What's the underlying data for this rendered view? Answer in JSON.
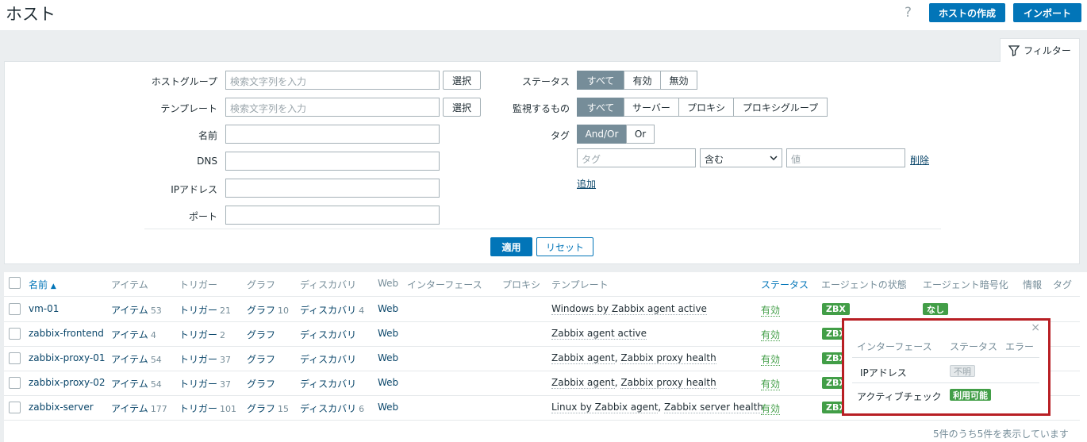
{
  "header": {
    "title": "ホスト",
    "help": "?",
    "create_host": "ホストの作成",
    "import": "インポート"
  },
  "filter": {
    "tab_label": "フィルター",
    "host_group_label": "ホストグループ",
    "host_group_placeholder": "検索文字列を入力",
    "template_label": "テンプレート",
    "template_placeholder": "検索文字列を入力",
    "select_label": "選択",
    "name_label": "名前",
    "dns_label": "DNS",
    "ip_label": "IPアドレス",
    "port_label": "ポート",
    "status_label": "ステータス",
    "status_options": [
      "すべて",
      "有効",
      "無効"
    ],
    "monitored_by_label": "監視するもの",
    "monitored_by_options": [
      "すべて",
      "サーバー",
      "プロキシ",
      "プロキシグループ"
    ],
    "tags_label": "タグ",
    "tags_options": [
      "And/Or",
      "Or"
    ],
    "tag_placeholder": "タグ",
    "tag_operator": "含む",
    "value_placeholder": "値",
    "remove": "削除",
    "add": "追加",
    "apply": "適用",
    "reset": "リセット"
  },
  "table": {
    "headers": {
      "name": "名前",
      "items": "アイテム",
      "triggers": "トリガー",
      "graphs": "グラフ",
      "discovery": "ディスカバリ",
      "web": "Web",
      "interface": "インターフェース",
      "proxy": "プロキシ",
      "templates": "テンプレート",
      "status": "ステータス",
      "agent_status": "エージェントの状態",
      "agent_encryption": "エージェント暗号化",
      "info": "情報",
      "tags": "タグ"
    },
    "rows": [
      {
        "name": "vm-01",
        "items": "アイテム",
        "items_count": "53",
        "triggers": "トリガー",
        "triggers_count": "21",
        "graphs": "グラフ",
        "graphs_count": "10",
        "discovery": "ディスカバリ",
        "discovery_count": "4",
        "web": "Web",
        "template1": "Windows by Zabbix agent active",
        "sep": "",
        "template2": "",
        "status": "有効",
        "agent": "ZBX",
        "encryption": "なし"
      },
      {
        "name": "zabbix-frontend",
        "items": "アイテム",
        "items_count": "4",
        "triggers": "トリガー",
        "triggers_count": "2",
        "graphs": "グラフ",
        "graphs_count": "",
        "discovery": "ディスカバリ",
        "discovery_count": "",
        "web": "Web",
        "template1": "Zabbix agent active",
        "sep": "",
        "template2": "",
        "status": "有効",
        "agent": "ZBX",
        "encryption": ""
      },
      {
        "name": "zabbix-proxy-01",
        "items": "アイテム",
        "items_count": "54",
        "triggers": "トリガー",
        "triggers_count": "37",
        "graphs": "グラフ",
        "graphs_count": "",
        "discovery": "ディスカバリ",
        "discovery_count": "",
        "web": "Web",
        "template1": "Zabbix agent",
        "sep": ", ",
        "template2": "Zabbix proxy health",
        "status": "有効",
        "agent": "ZBX",
        "encryption": ""
      },
      {
        "name": "zabbix-proxy-02",
        "items": "アイテム",
        "items_count": "54",
        "triggers": "トリガー",
        "triggers_count": "37",
        "graphs": "グラフ",
        "graphs_count": "",
        "discovery": "ディスカバリ",
        "discovery_count": "",
        "web": "Web",
        "template1": "Zabbix agent",
        "sep": ", ",
        "template2": "Zabbix proxy health",
        "status": "有効",
        "agent": "ZBX",
        "encryption": ""
      },
      {
        "name": "zabbix-server",
        "items": "アイテム",
        "items_count": "177",
        "triggers": "トリガー",
        "triggers_count": "101",
        "graphs": "グラフ",
        "graphs_count": "15",
        "discovery": "ディスカバリ",
        "discovery_count": "6",
        "web": "Web",
        "template1": "Linux by Zabbix agent",
        "sep": ", ",
        "template2": "Zabbix server health",
        "status": "有効",
        "agent": "ZBX",
        "encryption": ""
      }
    ],
    "footer": "5件のうち5件を表示しています"
  },
  "popup": {
    "close": "×",
    "headers": {
      "interface": "インターフェース",
      "status": "ステータス",
      "error": "エラー"
    },
    "rows": [
      {
        "interface": "IPアドレス",
        "status": "不明"
      },
      {
        "interface": "アクティブチェック",
        "status": "利用可能"
      }
    ]
  },
  "colors": {
    "primary": "#0275b8",
    "ok_green": "#429e47",
    "highlight_red": "#b81f24",
    "segment_active": "#768d99"
  }
}
